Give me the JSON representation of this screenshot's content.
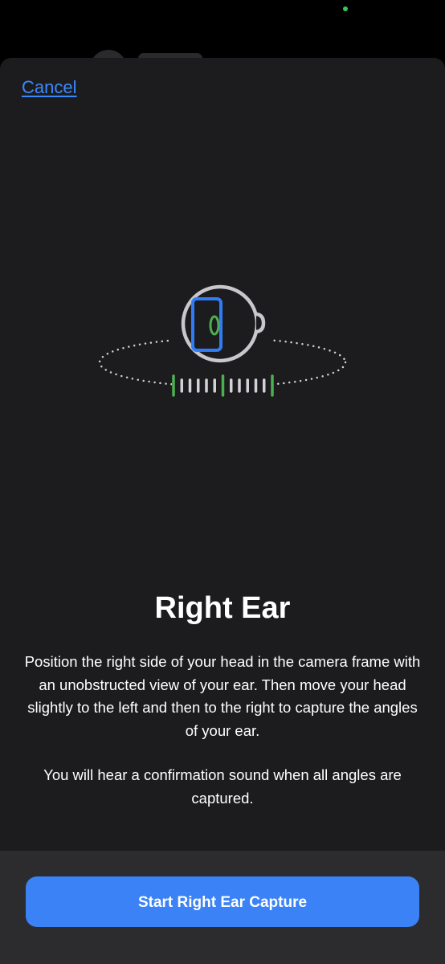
{
  "header": {
    "cancel_label": "Cancel"
  },
  "main": {
    "title": "Right Ear",
    "instructions": "Position the right side of your head in the camera frame with an unobstructed view of your ear. Then move your head slightly to the left and then to the right to capture the angles of your ear.",
    "confirmation_note": "You will hear a confirmation sound when all angles are captured."
  },
  "footer": {
    "start_button_label": "Start Right Ear Capture"
  },
  "illustration": {
    "icon": "head-rotation-ear-capture-icon",
    "ticks": [
      {
        "state": "captured"
      },
      {
        "state": "pending"
      },
      {
        "state": "pending"
      },
      {
        "state": "pending"
      },
      {
        "state": "pending"
      },
      {
        "state": "pending"
      },
      {
        "state": "captured"
      },
      {
        "state": "pending"
      },
      {
        "state": "pending"
      },
      {
        "state": "pending"
      },
      {
        "state": "pending"
      },
      {
        "state": "pending"
      },
      {
        "state": "captured"
      }
    ]
  },
  "colors": {
    "accent": "#3a82f6",
    "link": "#3a8aff",
    "captured": "#4caf50",
    "pending": "#d1d1d6",
    "sheet_background": "#1c1c1e",
    "footer_background": "#2c2c2e"
  }
}
